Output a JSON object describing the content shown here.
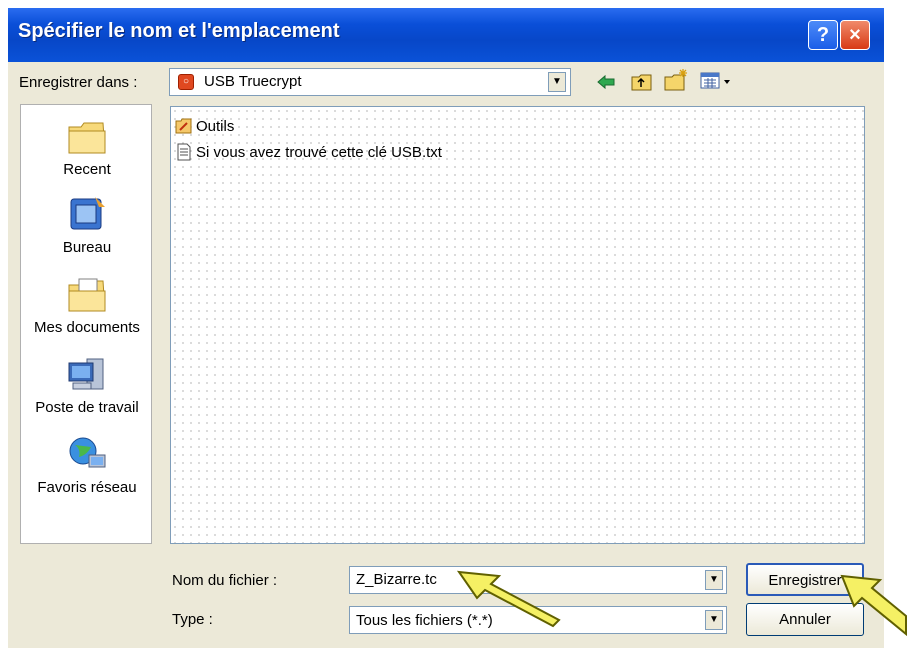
{
  "window": {
    "title": "Spécifier le nom et l'emplacement",
    "help_label": "?",
    "close_label": "×"
  },
  "toolbar": {
    "save_in_label": "Enregistrer dans :",
    "location": "USB Truecrypt",
    "back_icon": "back-arrow-icon",
    "up_icon": "folder-up-icon",
    "new_folder_icon": "new-folder-icon",
    "views_icon": "views-menu-icon"
  },
  "places": [
    {
      "label": "Recent",
      "icon": "recent-folder-icon"
    },
    {
      "label": "Bureau",
      "icon": "desktop-icon"
    },
    {
      "label": "Mes documents",
      "icon": "my-documents-icon"
    },
    {
      "label": "Poste de travail",
      "icon": "my-computer-icon"
    },
    {
      "label": "Favoris réseau",
      "icon": "network-places-icon"
    }
  ],
  "files": [
    {
      "name": "Outils",
      "icon": "folder-tools-icon"
    },
    {
      "name": "Si vous avez trouvé cette clé USB.txt",
      "icon": "text-file-icon"
    }
  ],
  "filename": {
    "label": "Nom du fichier :",
    "value": "Z_Bizarre.tc"
  },
  "filetype": {
    "label": "Type :",
    "value": "Tous les fichiers (*.*)"
  },
  "buttons": {
    "save": "Enregistrer",
    "cancel": "Annuler"
  },
  "colors": {
    "titlebar": "#0a4fd8",
    "dialog_bg": "#ece9d8",
    "annotation_arrow": "#f5f064"
  }
}
